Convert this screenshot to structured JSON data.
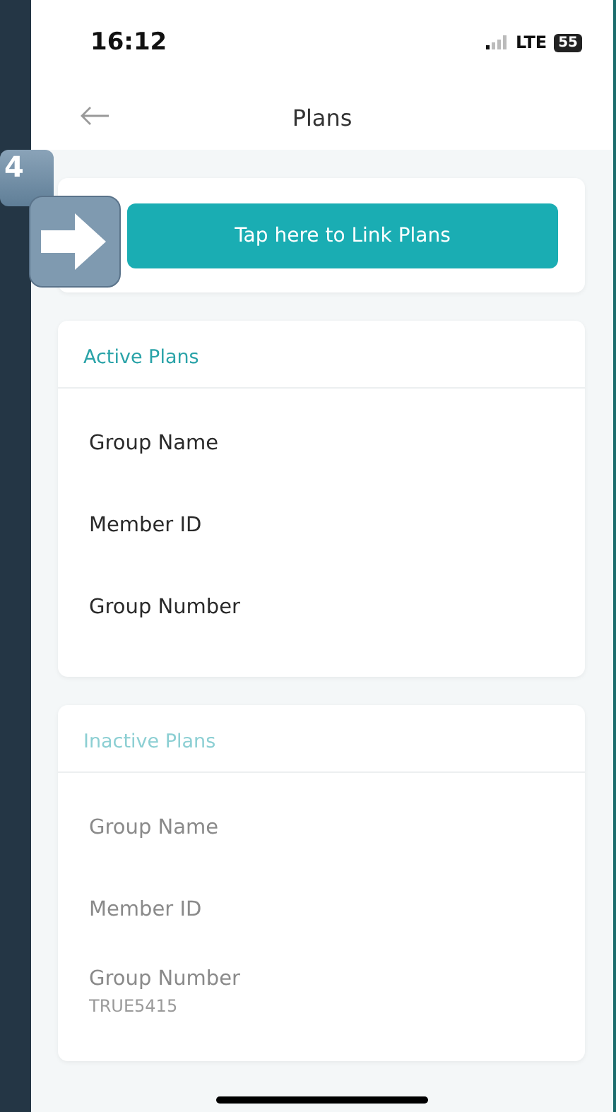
{
  "status_bar": {
    "time": "16:12",
    "network": "LTE",
    "battery": "55"
  },
  "header": {
    "title": "Plans"
  },
  "step_badge": {
    "number": "4"
  },
  "link_button": {
    "label": "Tap here to Link Plans"
  },
  "sections": [
    {
      "title": "Active Plans",
      "active": true,
      "fields": [
        {
          "label": "Group Name"
        },
        {
          "label": "Member ID"
        },
        {
          "label": "Group Number"
        }
      ]
    },
    {
      "title": "Inactive Plans",
      "active": false,
      "fields": [
        {
          "label": "Group Name"
        },
        {
          "label": "Member ID"
        },
        {
          "label": "Group Number",
          "value": "TRUE5415"
        }
      ]
    }
  ]
}
